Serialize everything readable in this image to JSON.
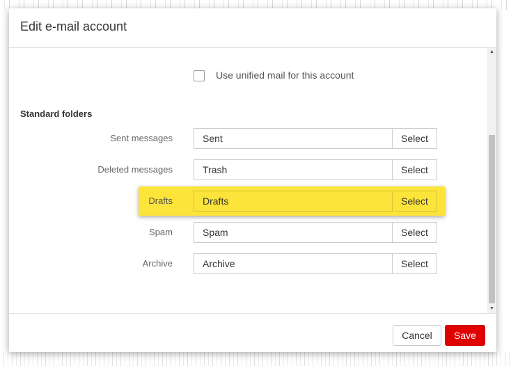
{
  "dialog": {
    "title": "Edit e-mail account"
  },
  "unified": {
    "label": "Use unified mail for this account",
    "checked": false
  },
  "standard_folders": {
    "title": "Standard folders",
    "select_label": "Select",
    "rows": [
      {
        "label": "Sent messages",
        "value": "Sent"
      },
      {
        "label": "Deleted messages",
        "value": "Trash"
      },
      {
        "label": "Drafts",
        "value": "Drafts"
      },
      {
        "label": "Spam",
        "value": "Spam"
      },
      {
        "label": "Archive",
        "value": "Archive"
      }
    ]
  },
  "footer": {
    "cancel_label": "Cancel",
    "save_label": "Save"
  },
  "colors": {
    "highlight": "#fce43a",
    "save_button": "#e00000"
  },
  "icons": {
    "scroll_up": "scroll-up-arrow-icon",
    "scroll_down": "scroll-down-arrow-icon"
  }
}
